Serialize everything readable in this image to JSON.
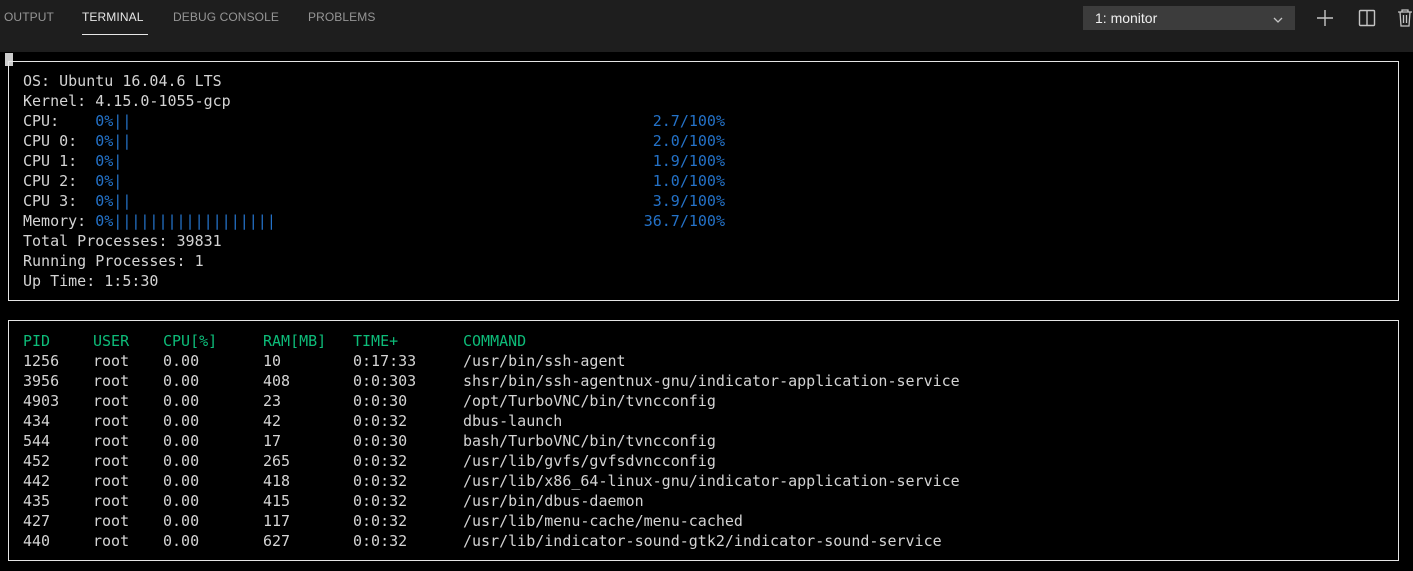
{
  "panel": {
    "tabs": [
      {
        "label": "OUTPUT"
      },
      {
        "label": "TERMINAL"
      },
      {
        "label": "DEBUG CONSOLE"
      },
      {
        "label": "PROBLEMS"
      }
    ],
    "active_tab": "TERMINAL",
    "terminal_select": {
      "value": "1: monitor"
    },
    "icons": [
      "chevron-down-icon",
      "plus-icon",
      "split-icon",
      "trash-icon"
    ]
  },
  "colors": {
    "terminal_bg": "#000000",
    "text": "#d4d4d4",
    "bar": "#2472c8",
    "header": "#0dbc79"
  },
  "system": {
    "os": "OS: Ubuntu 16.04.6 LTS",
    "kernel": "Kernel: 4.15.0-1055-gcp",
    "meters": [
      {
        "label": "CPU:    ",
        "pct": "0%",
        "bar": "||",
        "value": "2.7/100%"
      },
      {
        "label": "CPU 0:  ",
        "pct": "0%",
        "bar": "||",
        "value": "2.0/100%"
      },
      {
        "label": "CPU 1:  ",
        "pct": "0%",
        "bar": "|",
        "value": "1.9/100%"
      },
      {
        "label": "CPU 2:  ",
        "pct": "0%",
        "bar": "|",
        "value": "1.0/100%"
      },
      {
        "label": "CPU 3:  ",
        "pct": "0%",
        "bar": "||",
        "value": "3.9/100%"
      },
      {
        "label": "Memory: ",
        "pct": "0%",
        "bar": "||||||||||||||||||",
        "value": "36.7/100%"
      }
    ],
    "total_processes": "Total Processes: 39831",
    "running_processes": "Running Processes: 1",
    "uptime": "Up Time: 1:5:30"
  },
  "processes": {
    "columns": [
      "PID",
      "USER",
      "CPU[%]",
      "RAM[MB]",
      "TIME+",
      "COMMAND"
    ],
    "rows": [
      [
        "1256",
        "root",
        "0.00",
        "10",
        "0:17:33",
        "/usr/bin/ssh-agent"
      ],
      [
        "3956",
        "root",
        "0.00",
        "408",
        "0:0:303",
        "shsr/bin/ssh-agentnux-gnu/indicator-application-service"
      ],
      [
        "4903",
        "root",
        "0.00",
        "23",
        "0:0:30",
        "/opt/TurboVNC/bin/tvncconfig"
      ],
      [
        "434",
        "root",
        "0.00",
        "42",
        "0:0:32",
        "dbus-launch"
      ],
      [
        "544",
        "root",
        "0.00",
        "17",
        "0:0:30",
        "bash/TurboVNC/bin/tvncconfig"
      ],
      [
        "452",
        "root",
        "0.00",
        "265",
        "0:0:32",
        "/usr/lib/gvfs/gvfsdvncconfig"
      ],
      [
        "442",
        "root",
        "0.00",
        "418",
        "0:0:32",
        "/usr/lib/x86_64-linux-gnu/indicator-application-service"
      ],
      [
        "435",
        "root",
        "0.00",
        "415",
        "0:0:32",
        "/usr/bin/dbus-daemon"
      ],
      [
        "427",
        "root",
        "0.00",
        "117",
        "0:0:32",
        "/usr/lib/menu-cache/menu-cached"
      ],
      [
        "440",
        "root",
        "0.00",
        "627",
        "0:0:32",
        "/usr/lib/indicator-sound-gtk2/indicator-sound-service"
      ]
    ]
  }
}
